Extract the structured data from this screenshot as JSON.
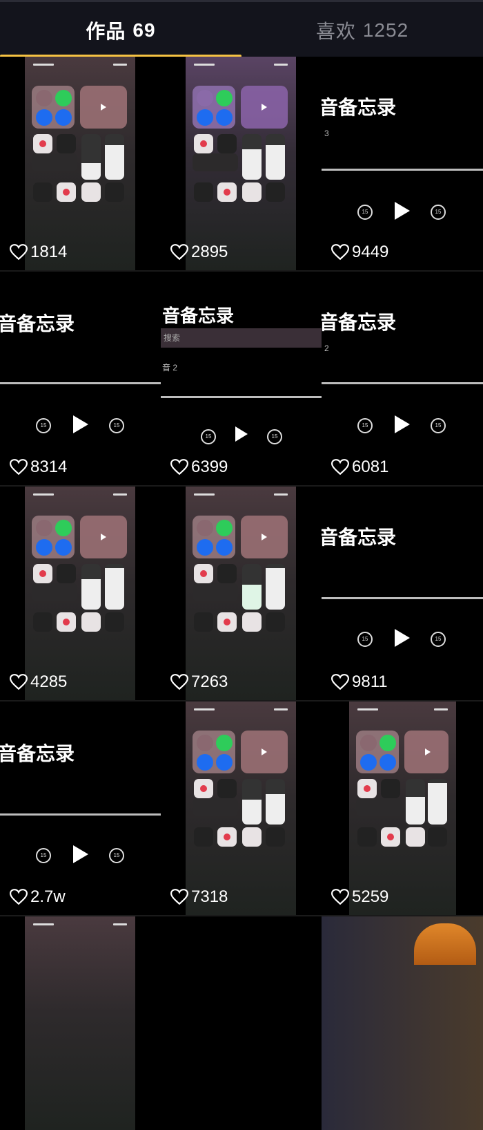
{
  "tabs": {
    "works_label": "作品",
    "works_count": "69",
    "likes_label": "喜欢",
    "likes_count": "1252"
  },
  "memo": {
    "title": "音备忘录",
    "search": "搜索",
    "item2": "音 2",
    "num3": "3",
    "num2": "2",
    "skip": "15"
  },
  "videos": [
    {
      "likes": "1814",
      "kind": "control-center"
    },
    {
      "likes": "2895",
      "kind": "control-center"
    },
    {
      "likes": "9449",
      "kind": "voice-memo"
    },
    {
      "likes": "8314",
      "kind": "voice-memo"
    },
    {
      "likes": "6399",
      "kind": "voice-memo"
    },
    {
      "likes": "6081",
      "kind": "voice-memo"
    },
    {
      "likes": "4285",
      "kind": "control-center"
    },
    {
      "likes": "7263",
      "kind": "control-center"
    },
    {
      "likes": "9811",
      "kind": "voice-memo"
    },
    {
      "likes": "2.7w",
      "kind": "voice-memo"
    },
    {
      "likes": "7318",
      "kind": "control-center"
    },
    {
      "likes": "5259",
      "kind": "control-center"
    }
  ],
  "colors": {
    "tab_underline": "#f6c343",
    "background": "#000000",
    "like_text": "#ffffff"
  }
}
